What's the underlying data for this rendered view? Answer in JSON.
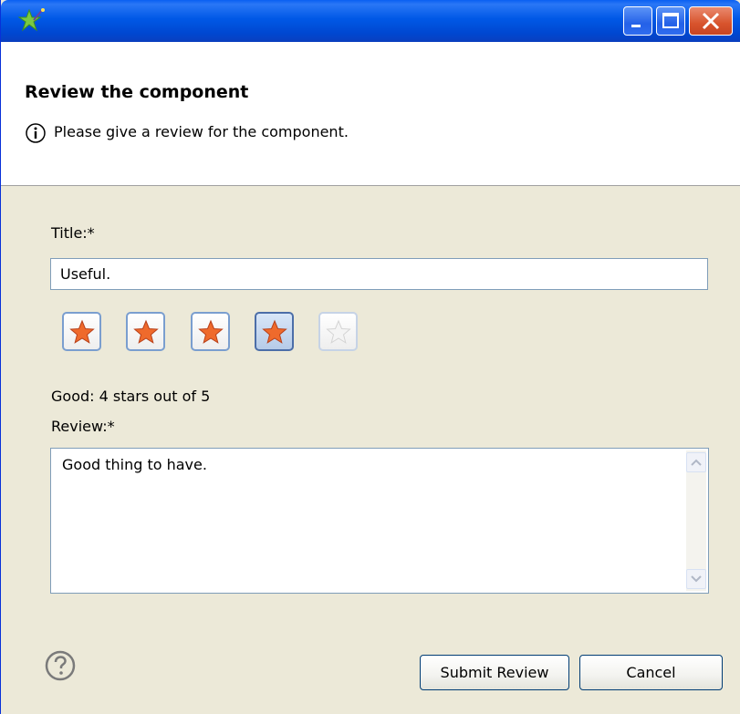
{
  "window": {
    "controls": {
      "minimize_icon": "minimize-icon",
      "maximize_icon": "maximize-icon",
      "close_icon": "close-icon"
    }
  },
  "header": {
    "title": "Review the component",
    "description": "Please give a review for the component.",
    "icon": "info-icon"
  },
  "form": {
    "title_label": "Title:*",
    "title_value": "Useful.",
    "rating": {
      "value": 4,
      "max": 5,
      "text": "Good: 4 stars out of 5"
    },
    "review_label": "Review:*",
    "review_value": "Good thing to have."
  },
  "footer": {
    "help_icon": "help-icon",
    "submit_label": "Submit Review",
    "cancel_label": "Cancel"
  },
  "colors": {
    "titlebar": "#0058e6",
    "dialog_bg": "#ece9d8",
    "star_filled": "#ef6a2c",
    "star_empty": "#d4d4d4"
  }
}
